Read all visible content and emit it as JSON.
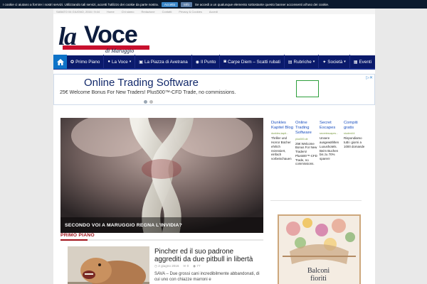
{
  "cookie_bar": {
    "text": "I cookie ci aiutano a fornire i nostri servizi. Utilizzando tali servizi, accetti l'utilizzo dei cookie da parte nostra.",
    "accept_label": "Accetto",
    "info_label": "Info",
    "scroll_text": "Se accedi a un qualunque elemento sottostante questo banner acconsenti all'uso dei cookie."
  },
  "top_strip": {
    "date": "SABATO 04 GIUGNO, 2016 / 9:44",
    "links": [
      "Home",
      "Chi siamo",
      "Redazione",
      "Contatti",
      "Privacy & Cookies",
      "Accedi"
    ]
  },
  "logo": {
    "part1": "la",
    "part2": "Voce",
    "subtitle": "di Maruggio"
  },
  "nav": {
    "items": [
      {
        "label": "Primo Piano",
        "icon": "star-icon",
        "caret": false
      },
      {
        "label": "La Voce",
        "icon": "comment-icon",
        "caret": true
      },
      {
        "label": "La Piazza di Avetrana",
        "icon": "image-icon",
        "caret": false
      },
      {
        "label": "Il Punto",
        "icon": "target-icon",
        "caret": false
      },
      {
        "label": "Carpe Diem – Scatti rubati",
        "icon": "camera-icon",
        "caret": false
      },
      {
        "label": "Rubriche",
        "icon": "book-icon",
        "caret": true
      },
      {
        "label": "Società",
        "icon": "globe-icon",
        "caret": true
      },
      {
        "label": "Eventi",
        "icon": "calendar-icon",
        "caret": false
      }
    ],
    "accent": "#0a1a6b",
    "home_color": "#0e73c8"
  },
  "ad_banner": {
    "title": "Online Trading Software",
    "text": "25€ Welcome Bonus For New Traders! Plus500™-CFD Trade, no commissions."
  },
  "featured": {
    "caption": "SECONDO VOI A MARUGGIO REGNA L'INVIDIA?"
  },
  "side_ads": [
    {
      "title": "Dunkles Kapitel Blog",
      "source": "dunkles-kapit...",
      "desc": "Thriller und Horror Bücher ehrlich rezensiert, einfach vorbeischauen"
    },
    {
      "title": "Online Trading Software",
      "source": "plus500.de",
      "desc": "25€ Welcome Bonus For New Traders! Plus500™-CFD Trade, no commissions."
    },
    {
      "title": "Secret Escapes",
      "source": "secretescapes...",
      "desc": "Unsere ausgewählten Luxushotels. Beim Buchen bis zu 70% sparen!"
    },
    {
      "title": "Compiti gratis",
      "source": "studenti.it",
      "desc": "Rispondiamo tutti i giorni a 1000 domande"
    }
  ],
  "side_image": {
    "text_line1": "Balconi",
    "text_line2": "fioriti"
  },
  "primo_piano": {
    "heading": "PRIMO PIANO",
    "article": {
      "title": "Pincher ed il suo padrone aggrediti da due pitbull in libertà",
      "date": "2 giugno 2016",
      "comments": "0",
      "views": "77",
      "excerpt": "SAVA – Due grossi cani incredibilmente abbandonati, di cui uno con chiazze marroni e"
    }
  },
  "colors": {
    "section_red": "#a1121b",
    "ad_blue": "#12296b",
    "link_blue": "#1a4fbf"
  }
}
